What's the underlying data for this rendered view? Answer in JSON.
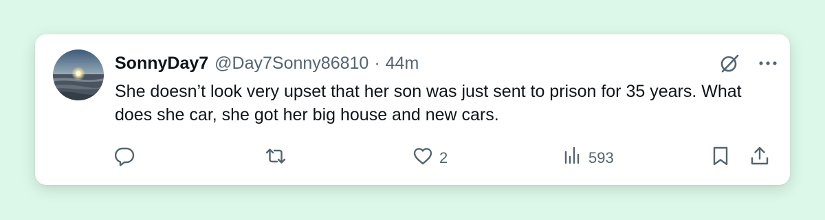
{
  "post": {
    "display_name": "SonnyDay7",
    "handle": "@Day7Sonny86810",
    "separator": "·",
    "time": "44m",
    "text": "She doesn’t look very upset that her son was just sent to prison for 35 years. What does she car, she got her big house and new cars."
  },
  "actions": {
    "reply": {
      "icon": "reply-icon"
    },
    "repost": {
      "icon": "repost-icon"
    },
    "like": {
      "icon": "heart-icon",
      "count": "2"
    },
    "views": {
      "icon": "views-icon",
      "count": "593"
    },
    "bookmark": {
      "icon": "bookmark-icon"
    },
    "share": {
      "icon": "share-icon"
    }
  },
  "colors": {
    "page_background": "#dcf8e8",
    "card_background": "#ffffff",
    "text_primary": "#0f1419",
    "text_secondary": "#536471"
  }
}
